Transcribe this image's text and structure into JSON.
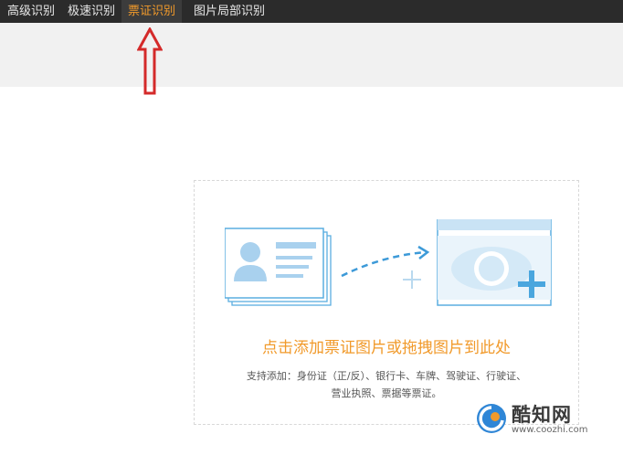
{
  "tabs": [
    {
      "label": "高级识别",
      "active": false
    },
    {
      "label": "极速识别",
      "active": false
    },
    {
      "label": "票证识别",
      "active": true
    },
    {
      "label": "图片局部识别",
      "active": false
    }
  ],
  "dropzone": {
    "title": "点击添加票证图片或拖拽图片到此处",
    "support_line1": "支持添加：身份证（正/反）、银行卡、车牌、驾驶证、行驶证、",
    "support_line2": "营业执照、票据等票证。"
  },
  "watermark": {
    "name": "酷知网",
    "url": "www.coozhi.com"
  },
  "colors": {
    "topbar": "#2b2b2b",
    "active_tab": "#f19a2b",
    "accent_blue": "#5aaee0",
    "arrow_red": "#d42a2a"
  },
  "icons": [
    "id-card-icon",
    "dashed-arrow-icon",
    "move-cursor-icon",
    "image-preview-add-icon",
    "up-arrow-annotation-icon",
    "coozhi-logo-icon"
  ]
}
